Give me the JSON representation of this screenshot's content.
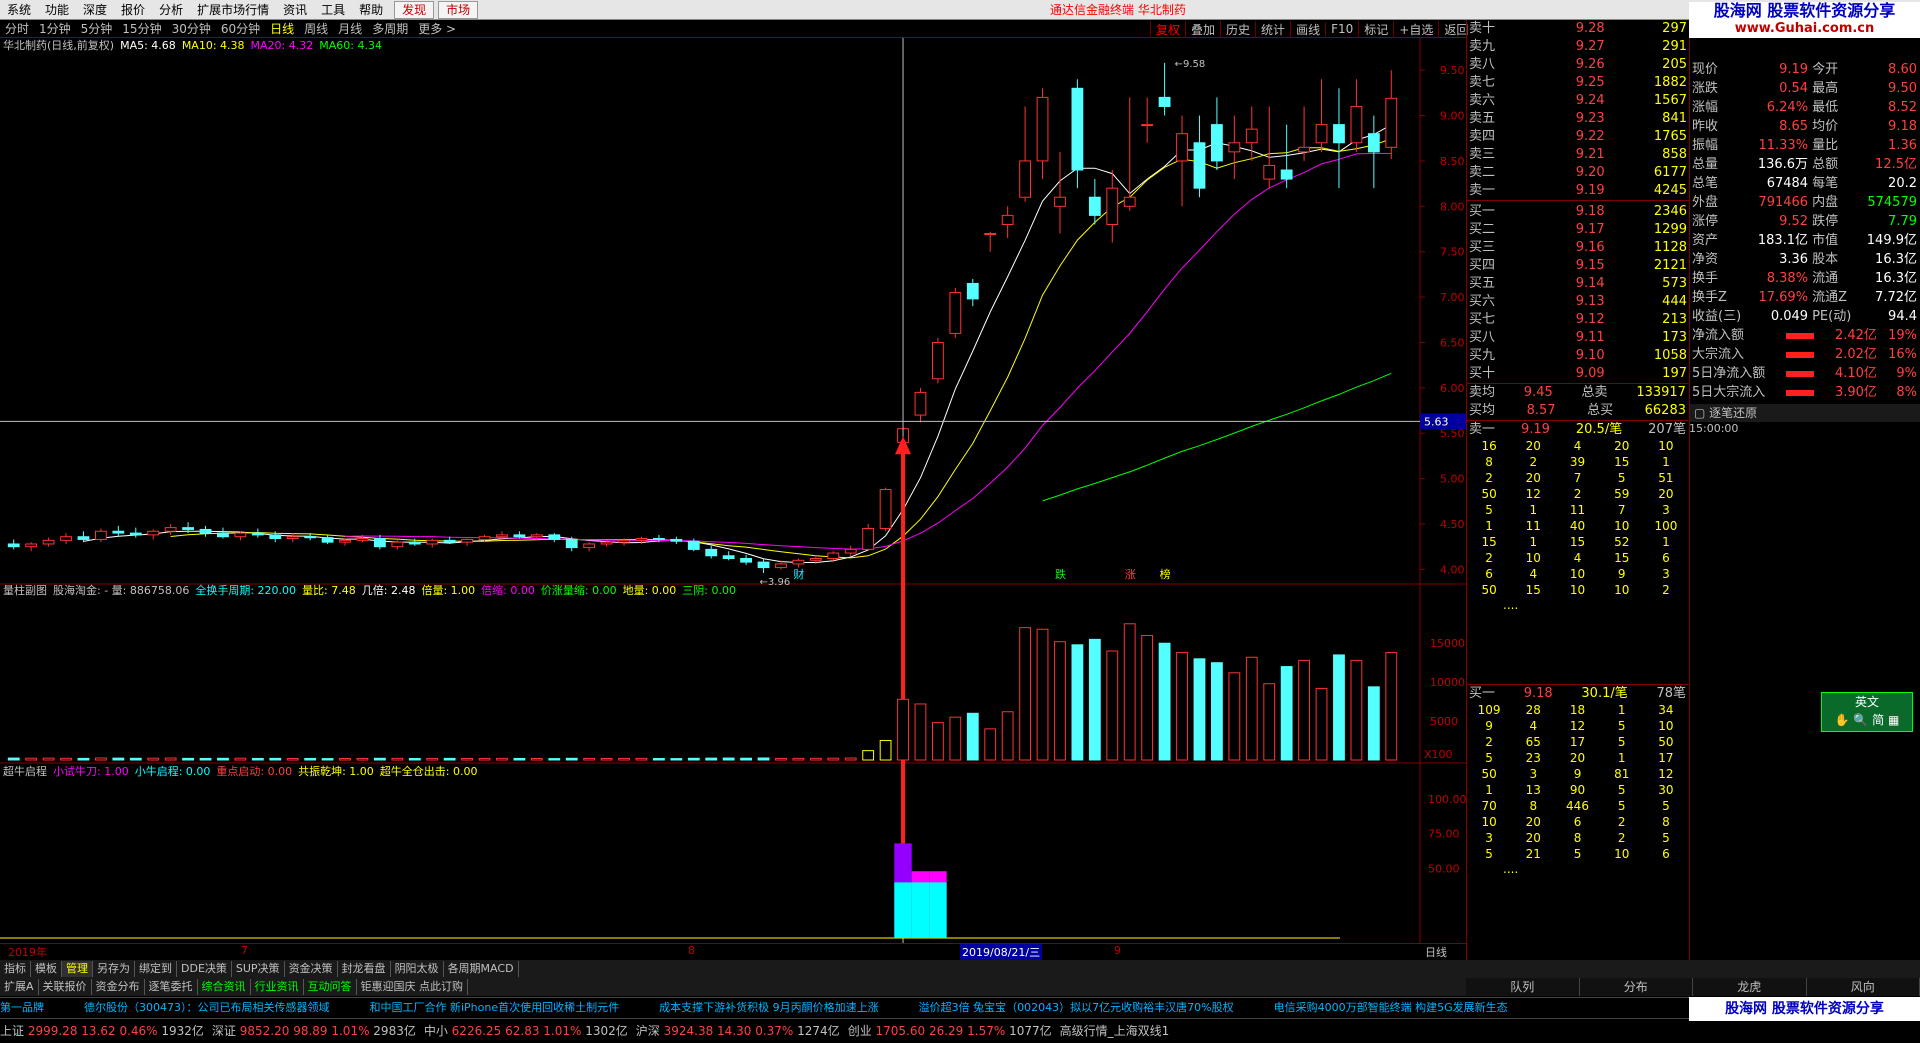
{
  "menu": {
    "items": [
      "系统",
      "功能",
      "深度",
      "报价",
      "分析",
      "扩展市场行情",
      "资讯",
      "工具",
      "帮助"
    ],
    "discover": "发现",
    "market": "市场"
  },
  "app_title": "通达信金融终端  华北制药",
  "period_tabs": [
    "分时",
    "1分钟",
    "5分钟",
    "15分钟",
    "30分钟",
    "60分钟",
    "日线",
    "周线",
    "月线",
    "多周期",
    "更多 >"
  ],
  "active_period": "日线",
  "chart_buttons": [
    "复权",
    "叠加",
    "历史",
    "统计",
    "画线",
    "F10",
    "标记",
    "+自选",
    "返回"
  ],
  "main_header": {
    "stock": "华北制药(日线,前复权)",
    "ma5": "MA5: 4.68",
    "ma10": "MA10: 4.38",
    "ma20": "MA20: 4.32",
    "ma60": "MA60: 4.34"
  },
  "price_axis": [
    "9.50",
    "9.00",
    "8.50",
    "8.00",
    "7.50",
    "7.00",
    "6.50",
    "6.00",
    "5.50",
    "5.00",
    "4.50",
    "4.00"
  ],
  "crosshair_price": "5.63",
  "high_label": "9.58",
  "low_label": "3.96",
  "event_marks": [
    "财",
    "跌",
    "涨",
    "榜"
  ],
  "volume_header": {
    "name": "量柱副图",
    "formula": "股海淘金: - 量: 886758.06",
    "items": [
      {
        "text": "全换手周期: 220.00",
        "color": "#00ffff"
      },
      {
        "text": "量比: 7.48",
        "color": "#ffff00"
      },
      {
        "text": "几倍: 2.48",
        "color": "#ffffff"
      },
      {
        "text": "倍量: 1.00",
        "color": "#ffff00"
      },
      {
        "text": "倍缩: 0.00",
        "color": "#ff00ff"
      },
      {
        "text": "价涨量缩: 0.00",
        "color": "#00ff00"
      },
      {
        "text": "地量: 0.00",
        "color": "#ffff00"
      },
      {
        "text": "三阴: 0.00",
        "color": "#00ff00"
      }
    ]
  },
  "volume_axis": [
    "15000",
    "10000",
    "5000",
    "X100"
  ],
  "ind2_header": {
    "name": "超牛启程",
    "items": [
      {
        "text": "小试牛刀: 1.00",
        "color": "#ff00ff"
      },
      {
        "text": "小牛启程: 0.00",
        "color": "#00ffff"
      },
      {
        "text": "重点启动: 0.00",
        "color": "#ff4040"
      },
      {
        "text": "共振乾坤: 1.00",
        "color": "#ffff00"
      },
      {
        "text": "超牛全仓出击: 0.00",
        "color": "#ffff00"
      }
    ]
  },
  "ind2_axis": [
    "100.00",
    "75.00",
    "50.00"
  ],
  "date_axis": {
    "year": "2019年",
    "m7": "7",
    "m8": "8",
    "cursor": "2019/08/21/三",
    "m9": "9",
    "period": "日线"
  },
  "bottom_tabs": [
    "指标",
    "模板",
    "管理",
    "另存为",
    "绑定到",
    "DDE决策",
    "SUP决策",
    "资金决策",
    "封龙看盘",
    "阴阳太极",
    "各周期MACD"
  ],
  "bottom_tabs2": [
    "扩展A",
    "关联报价",
    "资金分布",
    "逐笔委托",
    "综合资讯",
    "行业资讯",
    "互动问答",
    "钜惠迎国庆 点此订购"
  ],
  "order_book": {
    "sell": [
      [
        "卖十",
        "9.28",
        "297"
      ],
      [
        "卖九",
        "9.27",
        "291"
      ],
      [
        "卖八",
        "9.26",
        "205"
      ],
      [
        "卖七",
        "9.25",
        "1882"
      ],
      [
        "卖六",
        "9.24",
        "1567"
      ],
      [
        "卖五",
        "9.23",
        "841"
      ],
      [
        "卖四",
        "9.22",
        "1765"
      ],
      [
        "卖三",
        "9.21",
        "858"
      ],
      [
        "卖二",
        "9.20",
        "6177"
      ],
      [
        "卖一",
        "9.19",
        "4245"
      ]
    ],
    "buy": [
      [
        "买一",
        "9.18",
        "2346"
      ],
      [
        "买二",
        "9.17",
        "1299"
      ],
      [
        "买三",
        "9.16",
        "1128"
      ],
      [
        "买四",
        "9.15",
        "2121"
      ],
      [
        "买五",
        "9.14",
        "573"
      ],
      [
        "买六",
        "9.13",
        "444"
      ],
      [
        "买七",
        "9.12",
        "213"
      ],
      [
        "买八",
        "9.11",
        "173"
      ],
      [
        "买九",
        "9.10",
        "1058"
      ],
      [
        "买十",
        "9.09",
        "197"
      ]
    ],
    "avg_sell": [
      "卖均",
      "9.45",
      "总卖",
      "133917"
    ],
    "avg_buy": [
      "买均",
      "8.57",
      "总买",
      "66283"
    ]
  },
  "queue_sell": {
    "head": [
      "卖一",
      "9.19",
      "20.5/笔",
      "207笔"
    ],
    "rows": [
      [
        "16",
        "20",
        "4",
        "20",
        "10"
      ],
      [
        "8",
        "2",
        "39",
        "15",
        "1"
      ],
      [
        "2",
        "20",
        "7",
        "5",
        "51"
      ],
      [
        "50",
        "12",
        "2",
        "59",
        "20"
      ],
      [
        "5",
        "1",
        "11",
        "7",
        "3"
      ],
      [
        "1",
        "11",
        "40",
        "10",
        "100"
      ],
      [
        "15",
        "1",
        "15",
        "52",
        "1"
      ],
      [
        "2",
        "10",
        "4",
        "15",
        "6"
      ],
      [
        "6",
        "4",
        "10",
        "9",
        "3"
      ],
      [
        "50",
        "15",
        "10",
        "10",
        "2"
      ]
    ]
  },
  "queue_buy": {
    "head": [
      "买一",
      "9.18",
      "30.1/笔",
      "78笔"
    ],
    "rows": [
      [
        "109",
        "28",
        "18",
        "1",
        "34"
      ],
      [
        "9",
        "4",
        "12",
        "5",
        "10"
      ],
      [
        "2",
        "65",
        "17",
        "5",
        "50"
      ],
      [
        "5",
        "23",
        "20",
        "1",
        "17"
      ],
      [
        "50",
        "3",
        "9",
        "81",
        "12"
      ],
      [
        "1",
        "13",
        "90",
        "5",
        "30"
      ],
      [
        "70",
        "8",
        "446",
        "5",
        "5"
      ],
      [
        "10",
        "20",
        "6",
        "2",
        "8"
      ],
      [
        "3",
        "20",
        "8",
        "2",
        "5"
      ],
      [
        "5",
        "21",
        "5",
        "10",
        "6"
      ]
    ]
  },
  "stats": [
    [
      "现价",
      "9.19",
      "今开",
      "8.60"
    ],
    [
      "涨跌",
      "0.54",
      "最高",
      "9.50"
    ],
    [
      "涨幅",
      "6.24%",
      "最低",
      "8.52"
    ],
    [
      "昨收",
      "8.65",
      "均价",
      "9.18"
    ],
    [
      "振幅",
      "11.33%",
      "量比",
      "1.36"
    ],
    [
      "总量",
      "136.6万",
      "总额",
      "12.5亿"
    ],
    [
      "总笔",
      "67484",
      "每笔",
      "20.2"
    ],
    [
      "外盘",
      "791466",
      "内盘",
      "574579"
    ],
    [
      "涨停",
      "9.52",
      "跌停",
      "7.79"
    ],
    [
      "资产",
      "183.1亿",
      "市值",
      "149.9亿"
    ],
    [
      "净资",
      "3.36",
      "股本",
      "16.3亿"
    ],
    [
      "换手",
      "8.38%",
      "流通",
      "16.3亿"
    ],
    [
      "换手Z",
      "17.69%",
      "流通Z",
      "7.72亿"
    ],
    [
      "收益(三)",
      "0.049",
      "PE(动)",
      "94.4"
    ]
  ],
  "flows": [
    [
      "净流入额",
      "2.42亿",
      "19%"
    ],
    [
      "大宗流入",
      "2.02亿",
      "16%"
    ],
    [
      "5日净流入额",
      "4.10亿",
      "9%"
    ],
    [
      "5日大宗流入",
      "3.90亿",
      "8%"
    ]
  ],
  "tick_title": "逐笔还原",
  "tick_time": "15:00:00",
  "side_tabs": [
    "队列",
    "分布",
    "龙虎",
    "风向"
  ],
  "watermark": {
    "title": "股海网  股票软件资源分享",
    "url": "www.Guhai.com.cn"
  },
  "ime": {
    "label": "英文"
  },
  "news": [
    "第一品牌",
    "德尔股份（300473）：公司已布局相关传感器领域",
    "和中国工厂合作 新iPhone首次使用回收稀土制元件",
    "成本支撑下游补货积极 9月丙酮价格加速上涨",
    "溢价超3倍 兔宝宝（002043）拟以7亿元收购裕丰汉唐70%股权",
    "电信采购4000万部智能终端 构建5G发展新生态"
  ],
  "indices": [
    {
      "nm": "上证",
      "v": "2999.28",
      "c": "13.62",
      "p": "0.46%",
      "a": "1932亿"
    },
    {
      "nm": "深证",
      "v": "9852.20",
      "c": "98.89",
      "p": "1.01%",
      "a": "2983亿"
    },
    {
      "nm": "中小",
      "v": "6226.25",
      "c": "62.83",
      "p": "1.01%",
      "a": "1302亿"
    },
    {
      "nm": "沪深",
      "v": "3924.38",
      "c": "14.30",
      "p": "0.37%",
      "a": "1274亿"
    },
    {
      "nm": "创业",
      "v": "1705.60",
      "c": "26.29",
      "p": "1.57%",
      "a": "1077亿"
    }
  ],
  "status_right": "高级行情_上海双线1",
  "chart_data": {
    "type": "candlestick",
    "candles": [
      [
        4.28,
        4.33,
        4.22,
        4.25
      ],
      [
        4.25,
        4.3,
        4.2,
        4.28
      ],
      [
        4.28,
        4.35,
        4.25,
        4.32
      ],
      [
        4.32,
        4.4,
        4.28,
        4.36
      ],
      [
        4.36,
        4.42,
        4.3,
        4.33
      ],
      [
        4.33,
        4.45,
        4.3,
        4.42
      ],
      [
        4.42,
        4.48,
        4.36,
        4.4
      ],
      [
        4.4,
        4.46,
        4.35,
        4.38
      ],
      [
        4.38,
        4.44,
        4.33,
        4.42
      ],
      [
        4.42,
        4.5,
        4.38,
        4.46
      ],
      [
        4.46,
        4.52,
        4.4,
        4.44
      ],
      [
        4.44,
        4.48,
        4.36,
        4.4
      ],
      [
        4.4,
        4.46,
        4.34,
        4.36
      ],
      [
        4.36,
        4.42,
        4.32,
        4.4
      ],
      [
        4.4,
        4.45,
        4.35,
        4.38
      ],
      [
        4.38,
        4.42,
        4.3,
        4.34
      ],
      [
        4.34,
        4.4,
        4.3,
        4.36
      ],
      [
        4.36,
        4.4,
        4.32,
        4.35
      ],
      [
        4.35,
        4.38,
        4.28,
        4.3
      ],
      [
        4.3,
        4.34,
        4.26,
        4.32
      ],
      [
        4.32,
        4.38,
        4.3,
        4.34
      ],
      [
        4.34,
        4.38,
        4.22,
        4.25
      ],
      [
        4.25,
        4.32,
        4.22,
        4.3
      ],
      [
        4.3,
        4.34,
        4.26,
        4.28
      ],
      [
        4.28,
        4.34,
        4.24,
        4.32
      ],
      [
        4.32,
        4.36,
        4.28,
        4.3
      ],
      [
        4.3,
        4.34,
        4.26,
        4.33
      ],
      [
        4.33,
        4.38,
        4.3,
        4.36
      ],
      [
        4.36,
        4.42,
        4.32,
        4.38
      ],
      [
        4.38,
        4.42,
        4.34,
        4.36
      ],
      [
        4.36,
        4.4,
        4.32,
        4.38
      ],
      [
        4.38,
        4.4,
        4.3,
        4.33
      ],
      [
        4.33,
        4.36,
        4.2,
        4.24
      ],
      [
        4.24,
        4.3,
        4.2,
        4.28
      ],
      [
        4.28,
        4.32,
        4.25,
        4.3
      ],
      [
        4.3,
        4.34,
        4.26,
        4.32
      ],
      [
        4.32,
        4.36,
        4.28,
        4.34
      ],
      [
        4.34,
        4.38,
        4.3,
        4.33
      ],
      [
        4.33,
        4.36,
        4.28,
        4.31
      ],
      [
        4.31,
        4.34,
        4.2,
        4.22
      ],
      [
        4.22,
        4.26,
        4.12,
        4.15
      ],
      [
        4.15,
        4.2,
        4.1,
        4.12
      ],
      [
        4.12,
        4.16,
        4.05,
        4.08
      ],
      [
        4.08,
        4.12,
        3.96,
        4.02
      ],
      [
        4.02,
        4.1,
        4.0,
        4.06
      ],
      [
        4.06,
        4.12,
        4.02,
        4.1
      ],
      [
        4.1,
        4.16,
        4.06,
        4.12
      ],
      [
        4.12,
        4.2,
        4.08,
        4.18
      ],
      [
        4.18,
        4.26,
        4.14,
        4.22
      ],
      [
        4.22,
        4.5,
        4.2,
        4.45
      ],
      [
        4.45,
        4.9,
        4.42,
        4.88
      ],
      [
        5.4,
        5.58,
        5.38,
        5.55
      ],
      [
        5.7,
        6.0,
        5.62,
        5.95
      ],
      [
        6.1,
        6.55,
        6.05,
        6.5
      ],
      [
        6.6,
        7.1,
        6.55,
        7.05
      ],
      [
        7.15,
        7.2,
        6.9,
        6.98
      ],
      [
        7.7,
        7.72,
        7.5,
        7.7
      ],
      [
        7.8,
        8.0,
        7.65,
        7.9
      ],
      [
        8.1,
        9.1,
        8.05,
        8.5
      ],
      [
        8.5,
        9.3,
        8.3,
        9.2
      ],
      [
        8.0,
        8.6,
        7.7,
        8.1
      ],
      [
        9.3,
        9.4,
        8.2,
        8.4
      ],
      [
        8.1,
        8.3,
        7.8,
        7.9
      ],
      [
        7.8,
        8.4,
        7.6,
        8.2
      ],
      [
        8.0,
        9.2,
        7.95,
        8.1
      ],
      [
        8.9,
        9.2,
        8.7,
        8.9
      ],
      [
        9.2,
        9.58,
        9.0,
        9.1
      ],
      [
        8.5,
        9.0,
        8.0,
        8.8
      ],
      [
        8.7,
        9.0,
        8.1,
        8.2
      ],
      [
        8.9,
        9.2,
        8.4,
        8.5
      ],
      [
        8.6,
        9.0,
        8.3,
        8.7
      ],
      [
        8.7,
        9.1,
        8.5,
        8.85
      ],
      [
        8.3,
        9.1,
        8.2,
        8.45
      ],
      [
        8.4,
        8.9,
        8.2,
        8.3
      ],
      [
        8.6,
        9.1,
        8.5,
        8.65
      ],
      [
        8.7,
        9.4,
        8.6,
        8.9
      ],
      [
        8.9,
        9.3,
        8.2,
        8.7
      ],
      [
        8.7,
        9.4,
        8.6,
        9.1
      ],
      [
        8.8,
        9.0,
        8.2,
        8.6
      ],
      [
        8.65,
        9.5,
        8.52,
        9.19
      ]
    ],
    "volumes": [
      250,
      230,
      240,
      220,
      210,
      260,
      240,
      220,
      230,
      250,
      210,
      200,
      220,
      230,
      200,
      210,
      190,
      200,
      180,
      190,
      200,
      220,
      210,
      190,
      200,
      210,
      190,
      200,
      210,
      200,
      190,
      180,
      220,
      200,
      190,
      200,
      210,
      190,
      180,
      220,
      240,
      250,
      230,
      260,
      200,
      210,
      220,
      230,
      250,
      1200,
      2500,
      7800,
      7200,
      4800,
      5500,
      6000,
      4000,
      6200,
      17000,
      16800,
      15200,
      14800,
      15500,
      14000,
      17500,
      16000,
      15000,
      13800,
      13000,
      12500,
      11200,
      13200,
      9800,
      12000,
      12800,
      9200,
      13500,
      12800,
      9400,
      13800
    ],
    "ind2": {
      "cyan": [
        0,
        0,
        0,
        0,
        0,
        0,
        0,
        0,
        0,
        0,
        0,
        0,
        0,
        0,
        0,
        0,
        0,
        0,
        0,
        0,
        0,
        0,
        0,
        0,
        0,
        0,
        0,
        0,
        0,
        0,
        0,
        0,
        0,
        0,
        0,
        0,
        0,
        0,
        0,
        0,
        0,
        0,
        0,
        0,
        0,
        0,
        0,
        0,
        0,
        0,
        0,
        40,
        40,
        40,
        0,
        0,
        0,
        0,
        0,
        0,
        0,
        0,
        0,
        0,
        0,
        0,
        0,
        0,
        0,
        0,
        0,
        0,
        0,
        0,
        0,
        0,
        0,
        0,
        0,
        0
      ],
      "magenta": [
        0,
        0,
        0,
        0,
        0,
        0,
        0,
        0,
        0,
        0,
        0,
        0,
        0,
        0,
        0,
        0,
        0,
        0,
        0,
        0,
        0,
        0,
        0,
        0,
        0,
        0,
        0,
        0,
        0,
        0,
        0,
        0,
        0,
        0,
        0,
        0,
        0,
        0,
        0,
        0,
        0,
        0,
        0,
        0,
        0,
        0,
        0,
        0,
        0,
        0,
        0,
        68,
        48,
        48,
        0,
        0,
        0,
        0,
        0,
        0,
        0,
        0,
        0,
        0,
        0,
        0,
        0,
        0,
        0,
        0,
        0,
        0,
        0,
        0,
        0,
        0,
        0,
        0,
        0,
        0
      ]
    },
    "ylim": [
      3.85,
      9.7
    ],
    "vol_ylim": [
      0,
      18500
    ],
    "ind2_ylim": [
      0,
      115
    ]
  }
}
